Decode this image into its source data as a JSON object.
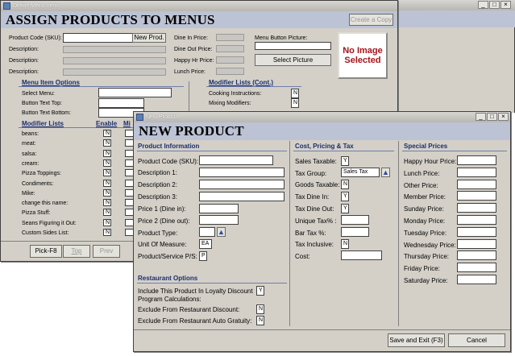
{
  "back": {
    "window_title": "Define Menu Items",
    "header": "ASSIGN PRODUCTS TO MENUS",
    "create_copy": "Create a Copy",
    "fields": {
      "product_code": "Product Code (SKU):",
      "new_prod": "New Prod.",
      "description": "Description:",
      "dine_in_price": "Dine In Price:",
      "dine_out_price": "Dine Out Price:",
      "happy_hr_price": "Happy Hr Price:",
      "lunch_price": "Lunch Price:",
      "menu_button_picture": "Menu Button Picture:",
      "select_picture": "Select Picture",
      "no_image": "No Image Selected"
    },
    "menu_item_options": {
      "title": "Menu Item Options",
      "select_menu": "Select Menu:",
      "button_text_top": "Button Text Top:",
      "button_text_bottom": "Button Text Bottom:"
    },
    "modifier_lists_cont": {
      "title": "Modifier Lists (Cont.)",
      "cooking_instructions": "Cooking Instructions:",
      "cooking_value": "N",
      "mixing_modifiers": "Mixing Modifiers:",
      "mixing_value": "N"
    },
    "modifier_lists": {
      "title": "Modifier Lists",
      "enable": "Enable",
      "min_partial": "Mi",
      "items": [
        {
          "label": "beans:",
          "value": "N"
        },
        {
          "label": "meat:",
          "value": "N"
        },
        {
          "label": "salsa:",
          "value": "N"
        },
        {
          "label": "cream:",
          "value": "N"
        },
        {
          "label": "Pizza Toppings:",
          "value": "N"
        },
        {
          "label": "Condiments:",
          "value": "N"
        },
        {
          "label": "Mike:",
          "value": "N"
        },
        {
          "label": "change this name:",
          "value": "N"
        },
        {
          "label": "Pizza Stuff:",
          "value": "N"
        },
        {
          "label": "Seans Figuring it Out:",
          "value": "N"
        },
        {
          "label": "Custom Sides List:",
          "value": "N"
        }
      ]
    },
    "bottom": {
      "pick": "Pick-F8",
      "top": "Top",
      "prev": "Prev"
    }
  },
  "front": {
    "window_title": "New Product",
    "header": "NEW PRODUCT",
    "product_info": {
      "title": "Product Information",
      "product_code": "Product Code (SKU):",
      "desc1": "Description 1:",
      "desc2": "Description 2:",
      "desc3": "Description 3:",
      "price1": "Price 1 (Dine in):",
      "price2": "Price 2 (Dine out):",
      "product_type": "Product Type:",
      "unit_of_measure": "Unit Of Measure:",
      "unit_value": "EA",
      "service": "Product/Service P/S:",
      "service_value": "P"
    },
    "restaurant_options": {
      "title": "Restaurant Options",
      "loyalty_line1": "Include This Product In Loyalty Discount",
      "loyalty_line2": "Program Calculations:",
      "loyalty_value": "Y",
      "exclude_discount": "Exclude From Restaurant Discount:",
      "exclude_discount_value": "N",
      "exclude_gratuity": "Exclude From Restaurant Auto Gratuity:",
      "exclude_gratuity_value": "N"
    },
    "cost_pricing": {
      "title": "Cost, Pricing & Tax",
      "sales_taxable": "Sales Taxable:",
      "sales_taxable_value": "Y",
      "tax_group": "Tax Group:",
      "tax_group_value": "Sales Tax",
      "goods_taxable": "Goods Taxable:",
      "goods_taxable_value": "N",
      "tax_dine_in": "Tax Dine In:",
      "tax_dine_in_value": "Y",
      "tax_dine_out": "Tax Dine Out:",
      "tax_dine_out_value": "Y",
      "unique_tax": "Unique Tax% :",
      "bar_tax": "Bar Tax %:",
      "tax_inclusive": "Tax Inclusive:",
      "tax_inclusive_value": "N",
      "cost": "Cost:"
    },
    "special_prices": {
      "title": "Special Prices",
      "items": [
        "Happy Hour Price:",
        "Lunch Price:",
        "Other Price:",
        "Member Price:",
        "Sunday Price:",
        "Monday Price:",
        "Tuesday Price:",
        "Wednesday Price:",
        "Thursday Price:",
        "Friday Price:",
        "Saturday Price:"
      ]
    },
    "save_exit": "Save and Exit (F3)",
    "cancel": "Cancel"
  }
}
